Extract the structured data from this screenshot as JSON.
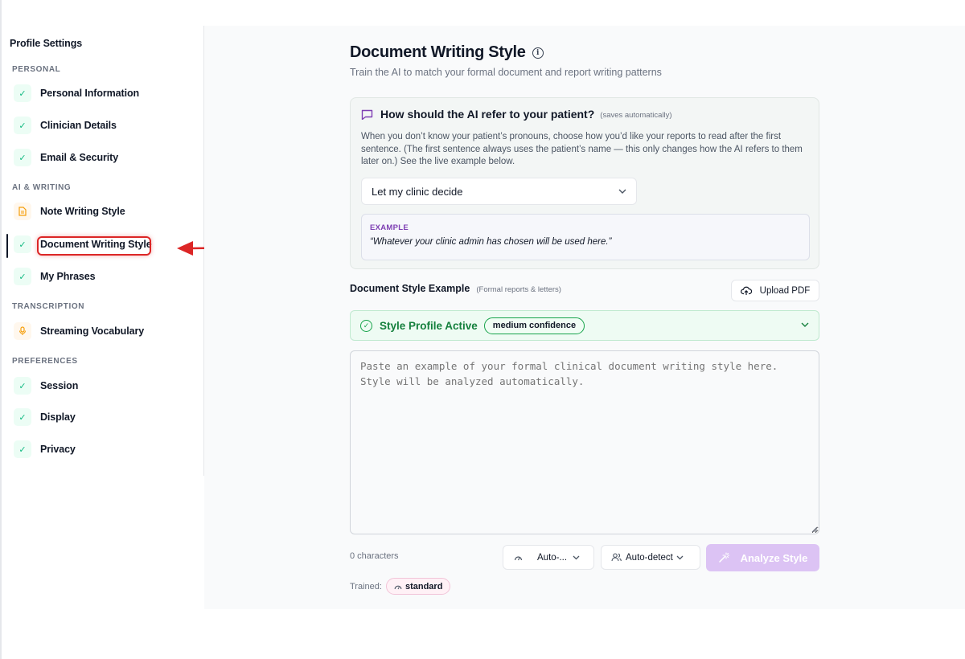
{
  "sidebar": {
    "title": "Profile Settings",
    "sections": {
      "personal": "PERSONAL",
      "ai_writing": "AI & WRITING",
      "transcription": "TRANSCRIPTION",
      "preferences": "PREFERENCES"
    },
    "items": {
      "personal_information": "Personal Information",
      "clinician_details": "Clinician Details",
      "email_security": "Email & Security",
      "note_writing_style": "Note Writing Style",
      "document_writing_style": "Document Writing Style",
      "my_phrases": "My Phrases",
      "streaming_vocabulary": "Streaming Vocabulary",
      "session": "Session",
      "display": "Display",
      "privacy": "Privacy"
    },
    "active_item": "Document Writing Style"
  },
  "main": {
    "title": "Document Writing Style",
    "subtitle": "Train the AI to match your formal document and report writing patterns",
    "pronoun_card": {
      "title": "How should the AI refer to your patient?",
      "note": "(saves automatically)",
      "description": "When you don’t know your patient’s pronouns, choose how you’d like your reports to read after the first sentence. (The first sentence always uses the patient’s name — this only changes how the AI refers to them later on.) See the live example below.",
      "select_value": "Let my clinic decide",
      "example_label": "EXAMPLE",
      "example_text": "“Whatever your clinic admin has chosen will be used here.”"
    },
    "doc_example": {
      "label": "Document Style Example",
      "hint": "(Formal reports & letters)",
      "upload_label": "Upload PDF"
    },
    "profile": {
      "title": "Style Profile Active",
      "confidence": "medium confidence"
    },
    "textarea": {
      "placeholder": "Paste an example of your formal clinical document writing style here. Style will be analyzed automatically.",
      "value": ""
    },
    "footer": {
      "char_count": "0 characters",
      "auto1_label": "Auto-...",
      "auto2_label": "Auto-detect",
      "analyze_label": "Analyze Style",
      "trained_label": "Trained:",
      "trained_value": "standard"
    }
  },
  "colors": {
    "accent_green": "#16a34a",
    "analyze_disabled": "#dcc3f4",
    "annotation_red": "#dc2626",
    "example_label": "#7e3fb3"
  }
}
